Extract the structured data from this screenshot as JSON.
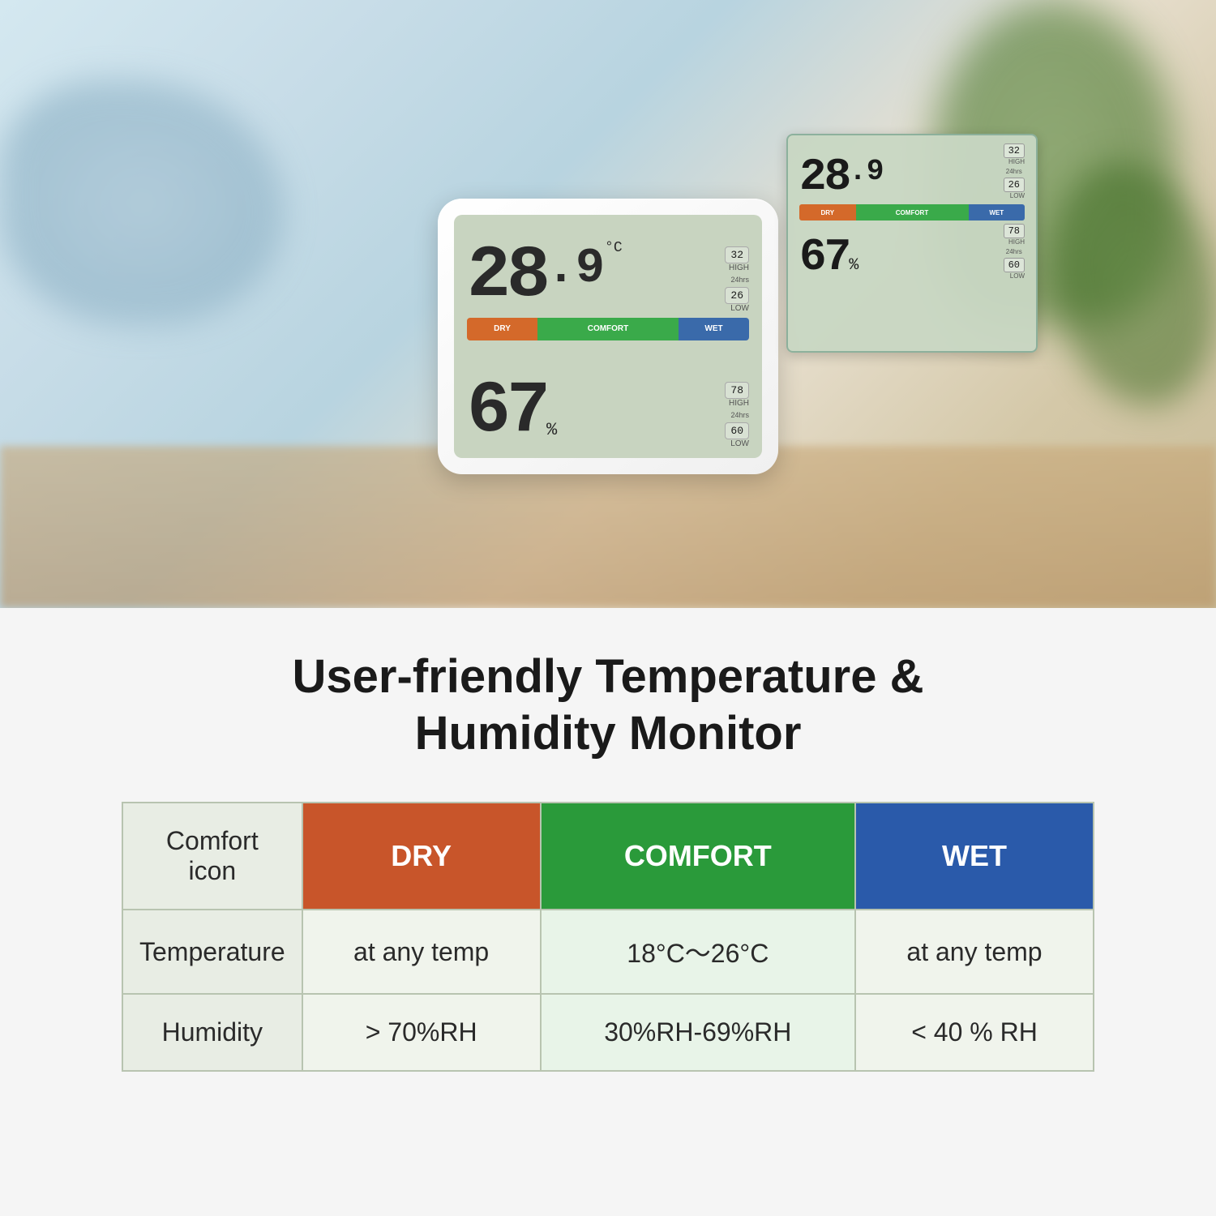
{
  "photo": {
    "alt": "Temperature and humidity monitor on wooden desk"
  },
  "device": {
    "temperature": "28",
    "temp_decimal": ".9",
    "temp_unit": "°C",
    "high_label": "HIGH",
    "high_value": "32",
    "low_label": "LOW",
    "low_value": "26",
    "hrs_label": "24hrs",
    "humidity": "67",
    "hum_unit": "%",
    "hum_high_value": "78",
    "hum_low_value": "60",
    "bar_dry": "DRY",
    "bar_comfort": "COMFORT",
    "bar_wet": "WET"
  },
  "zoom": {
    "temperature": "28",
    "temp_decimal": ".9",
    "high_value": "32",
    "low_value": "26",
    "humidity": "67",
    "hum_high": "78",
    "hum_low": "60",
    "bar_dry": "DRY",
    "bar_comfort": "COMFORT",
    "bar_wet": "WET",
    "high_label": "HIGH",
    "low_label": "LOW"
  },
  "title": {
    "line1": "User-friendly Temperature &",
    "line2": "Humidity Monitor"
  },
  "table": {
    "row1": {
      "header": "Comfort icon",
      "dry": "DRY",
      "comfort": "COMFORT",
      "wet": "WET"
    },
    "row2": {
      "header": "Temperature",
      "dry": "at any temp",
      "comfort": "18°C～26°C",
      "wet": "at any temp"
    },
    "row3": {
      "header": "Humidity",
      "dry": "> 70%RH",
      "comfort": "30%RH-69%RH",
      "wet": "< 40 % RH"
    }
  }
}
